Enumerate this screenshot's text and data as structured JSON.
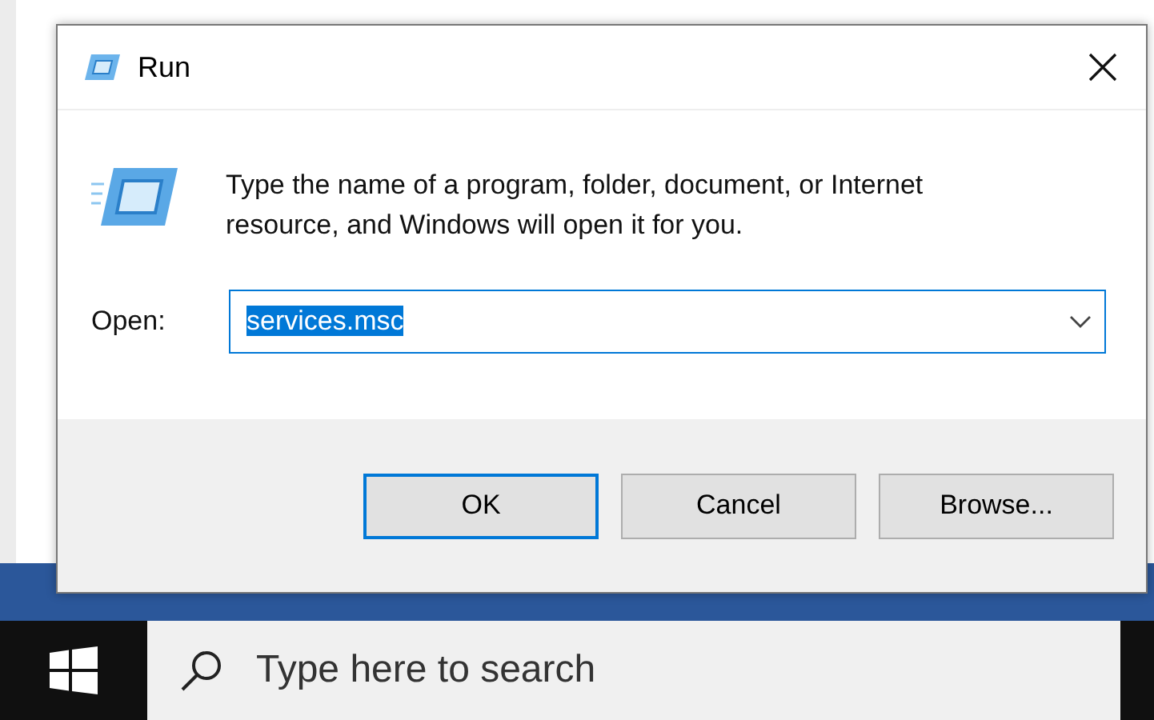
{
  "taskbar": {
    "search": {
      "placeholder": "Type here to search"
    }
  },
  "dialog": {
    "title": "Run",
    "description": "Type the name of a program, folder, document, or Internet resource, and Windows will open it for you.",
    "open_label": "Open:",
    "open_value": "services.msc",
    "value_highlighted": true,
    "buttons": [
      {
        "label": "OK",
        "default": true
      },
      {
        "label": "Cancel",
        "default": false
      },
      {
        "label": "Browse...",
        "default": false
      }
    ]
  }
}
